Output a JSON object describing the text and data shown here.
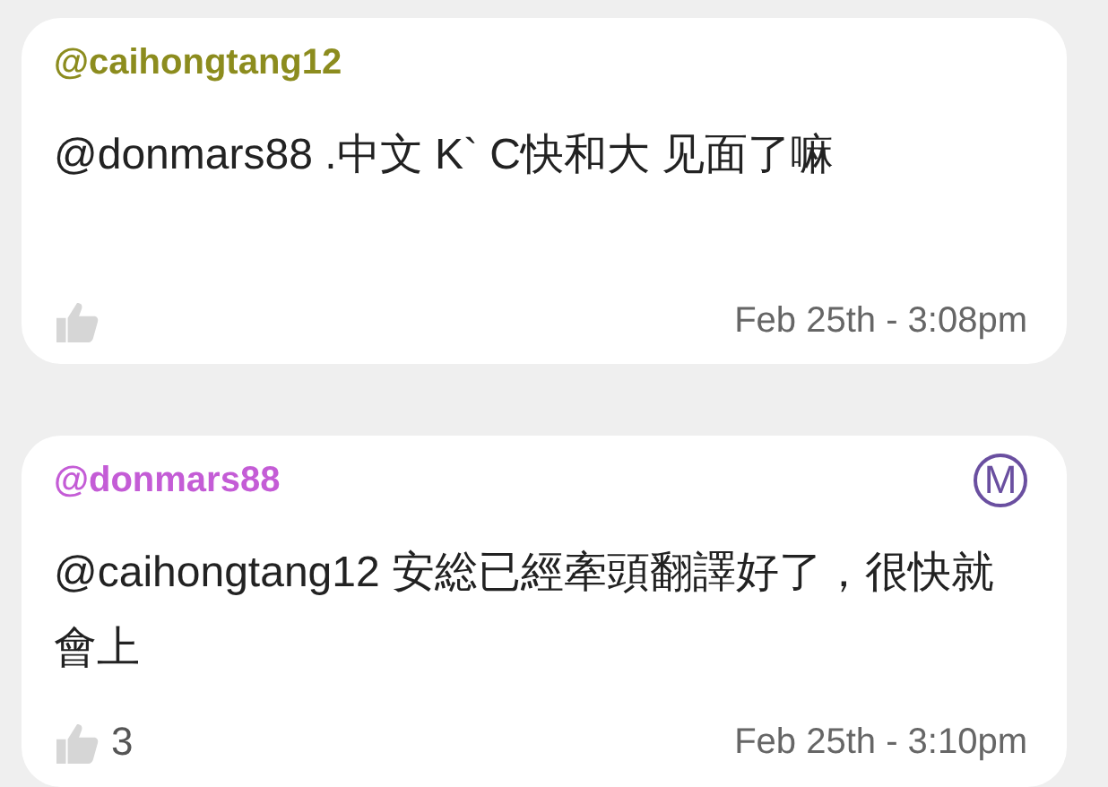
{
  "comments": [
    {
      "author": "@caihongtang12",
      "color": "#8c8c1e",
      "body": "@donmars88 .中文 K` C快和大 见面了嘛",
      "time": "Feb 25th - 3:08pm"
    },
    {
      "author": "@donmars88",
      "color": "#c45cd6",
      "badge": "M",
      "body": "@caihongtang12 安総已經牽頭翻譯好了，很快就會上",
      "likes": "3",
      "time": "Feb 25th - 3:10pm"
    }
  ]
}
